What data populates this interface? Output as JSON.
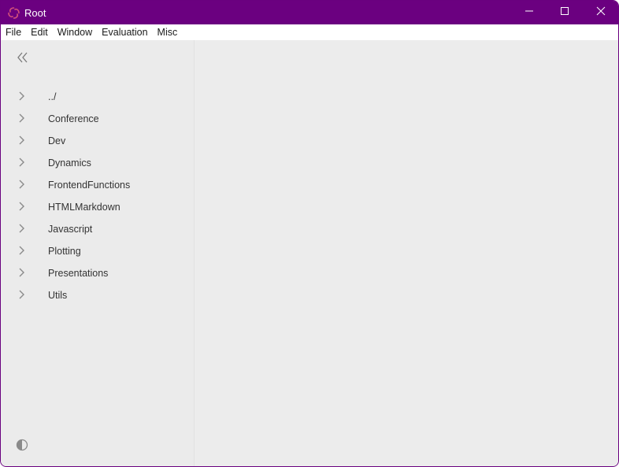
{
  "window": {
    "title": "Root",
    "logo_icon": "swirl-logo-icon",
    "controls": {
      "minimize_icon": "minimize-icon",
      "maximize_icon": "maximize-icon",
      "close_icon": "close-icon"
    },
    "accent_color": "#6b0080"
  },
  "menubar": {
    "items": [
      {
        "label": "File"
      },
      {
        "label": "Edit"
      },
      {
        "label": "Window"
      },
      {
        "label": "Evaluation"
      },
      {
        "label": "Misc"
      }
    ]
  },
  "sidebar": {
    "collapse_icon": "chevrons-left-icon",
    "tree": [
      {
        "label": "../",
        "icon": "chevron-right-icon"
      },
      {
        "label": "Conference",
        "icon": "chevron-right-icon"
      },
      {
        "label": "Dev",
        "icon": "chevron-right-icon"
      },
      {
        "label": "Dynamics",
        "icon": "chevron-right-icon"
      },
      {
        "label": "FrontendFunctions",
        "icon": "chevron-right-icon"
      },
      {
        "label": "HTMLMarkdown",
        "icon": "chevron-right-icon"
      },
      {
        "label": "Javascript",
        "icon": "chevron-right-icon"
      },
      {
        "label": "Plotting",
        "icon": "chevron-right-icon"
      },
      {
        "label": "Presentations",
        "icon": "chevron-right-icon"
      },
      {
        "label": "Utils",
        "icon": "chevron-right-icon"
      }
    ],
    "theme_toggle_icon": "contrast-icon"
  }
}
